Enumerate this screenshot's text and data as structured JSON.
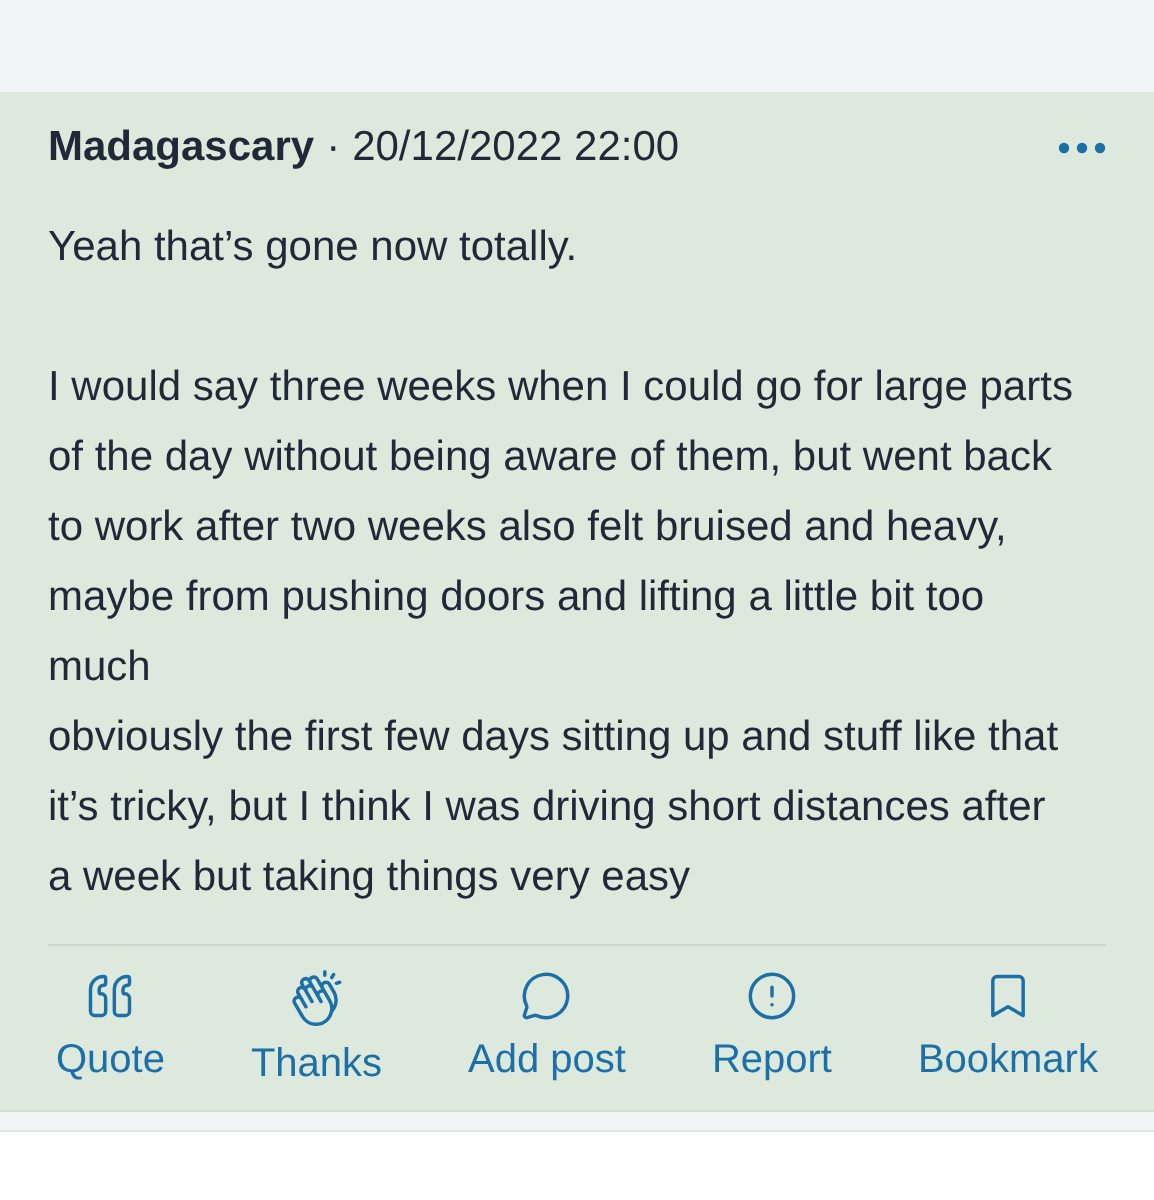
{
  "post": {
    "author": "Madagascary",
    "separator": "·",
    "timestamp": "20/12/2022 22:00",
    "paragraphs": [
      "Yeah that’s gone now totally.",
      "I would say three weeks when I could go for large parts of the day without being aware of them, but went back to work after two weeks also felt bruised and heavy, maybe from pushing doors and lifting a little bit too much\nobviously the first few days sitting up and stuff like that it’s tricky, but I think I was driving short distances after a week but taking things very easy"
    ],
    "actions": [
      {
        "label": "Quote"
      },
      {
        "label": "Thanks"
      },
      {
        "label": "Add post"
      },
      {
        "label": "Report"
      },
      {
        "label": "Bookmark"
      }
    ]
  }
}
